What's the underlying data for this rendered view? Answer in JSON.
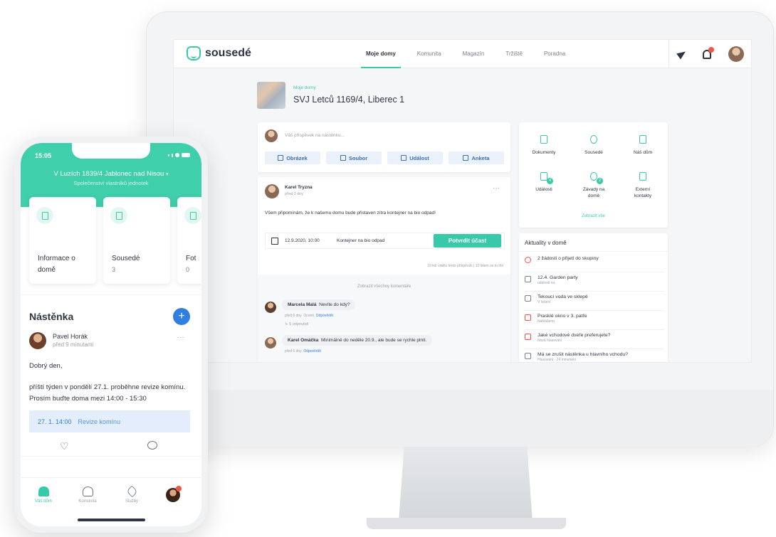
{
  "desktop": {
    "brand": "sousedé",
    "nav_tabs": [
      "Moje domy",
      "Komunita",
      "Magazín",
      "Tržiště",
      "Poradna"
    ],
    "breadcrumb": "Moje domy",
    "building_title": "SVJ Letců 1169/4, Liberec 1",
    "composer": {
      "placeholder": "Váš příspěvek na nástěnku...",
      "buttons": [
        "Obrázek",
        "Soubor",
        "Událost",
        "Anketa"
      ]
    },
    "post": {
      "author": "Karel Tryzna",
      "time": "před 3 dny",
      "text": "Všem připomínám, že k našemu domu bude přistaven zítra kontejner na bio odpad!",
      "event_date": "12.9.2020, 10:00",
      "event_title": "Kontejner na bio odpad",
      "confirm_button": "Potvrdit účast",
      "stats": "33 lidí vidělo tento příspěvek  |  10 lidem se to líbí",
      "show_comments": "Zobrazit všechny komentáře",
      "comments": [
        {
          "author": "Marcela Malá",
          "text": "Nevíte do kdy?",
          "meta": "před 6 dny",
          "action1": "Ocenit",
          "action2": "Odpovědět",
          "replies": "↳ 5 odpovědí"
        },
        {
          "author": "Karel Omáčka",
          "text": "Minimálně do neděle 20.9., ale bude se rychle plnit.",
          "meta": "před 6 dny",
          "action2": "Odpovědět"
        }
      ]
    },
    "sidebar_icons": [
      {
        "label": "Dokumenty",
        "icon": "document-icon"
      },
      {
        "label": "Sousedé",
        "icon": "neighbors-icon"
      },
      {
        "label": "Náš dům",
        "icon": "building-icon"
      },
      {
        "label": "Události",
        "icon": "calendar-icon",
        "badge": "4"
      },
      {
        "label": "Závady na domě",
        "icon": "issue-icon",
        "badge": "2"
      },
      {
        "label": "Externí kontakty",
        "icon": "contacts-icon"
      }
    ],
    "show_all": "Zobrazit vše",
    "news_title": "Aktuality v domě",
    "news": [
      {
        "title": "2 žádosti o přijetí do skupiny",
        "sub": "",
        "color": "#f0554a"
      },
      {
        "title": "12.4. Garden party",
        "sub": "události na",
        "color": "#7a8190"
      },
      {
        "title": "Tekoucí voda ve sklepě",
        "sub": "V řešení",
        "color": "#7a8190"
      },
      {
        "title": "Prasklé okno v 3. patře",
        "sub": "Nahlášeno",
        "color": "#f0554a"
      },
      {
        "title": "Jaké vchodové dveře preferujete?",
        "sub": "Nová hlasování",
        "color": "#f0554a"
      },
      {
        "title": "Má se zrušit nástěnka u hlavního vchodu?",
        "sub": "Hlasování · 24 minutami",
        "color": "#7a8190"
      }
    ]
  },
  "phone": {
    "time": "15:05",
    "address": "V Luzích 1839/4 Jablonec nad Nisou",
    "subtitle": "Společenství vlastníků jednotek",
    "cards": [
      {
        "label": "Informace o domě",
        "value": ""
      },
      {
        "label": "Sousedé",
        "value": "3"
      },
      {
        "label": "Fot",
        "value": "0"
      }
    ],
    "board_title": "Nástěnka",
    "post_author": "Pavel Horák",
    "post_time": "před 9 minutami",
    "greeting": "Dobrý den,",
    "body": "příští týden v pondělí 27.1. proběhne revize komínu. Prosím buďte doma mezi 14:00 - 15:30",
    "event_time": "27. 1. 14:00",
    "event_title": "Revize komínu",
    "tabbar": [
      "Váš dům",
      "Komunita",
      "Služby"
    ]
  },
  "colors": {
    "accent": "#38c9a8",
    "link": "#2f7fe0",
    "alert": "#f0554a"
  }
}
